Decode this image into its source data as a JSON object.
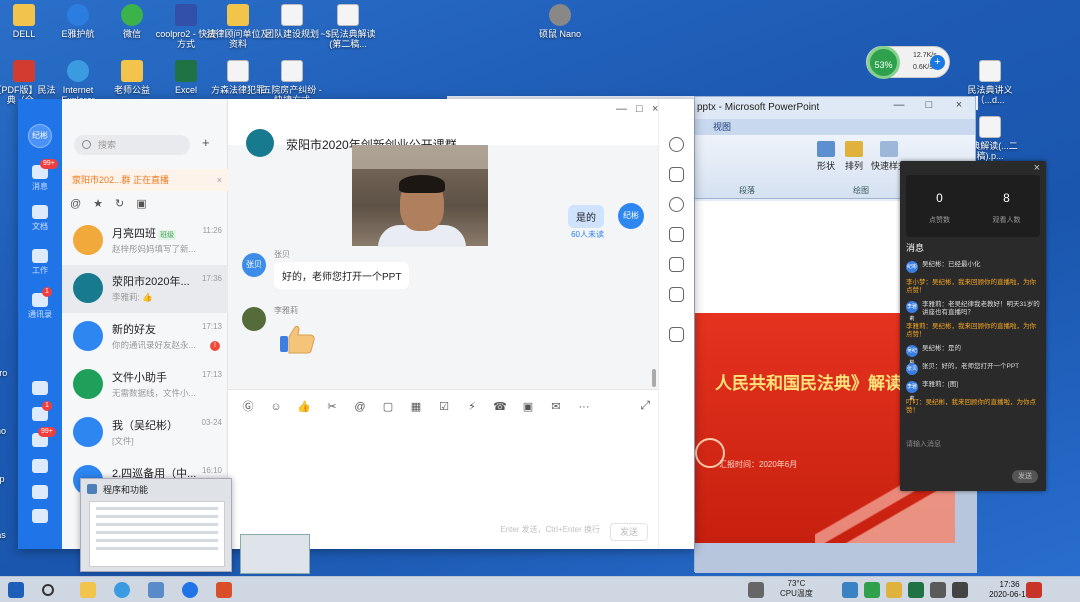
{
  "desktop": {
    "icons": [
      {
        "label": "DELL",
        "icon": "folder-icon"
      },
      {
        "label": "E雅护航",
        "icon": "edge-icon"
      },
      {
        "label": "微信",
        "icon": "wechat-icon"
      },
      {
        "label": "coolpro2 - 快捷方式",
        "icon": "coolpro-icon"
      },
      {
        "label": "法律顾问单位及资料",
        "icon": "folder-icon"
      },
      {
        "label": "团队建设规划",
        "icon": "doc-icon"
      },
      {
        "label": "~$民法典解读(第二稿...",
        "icon": "doc-icon"
      },
      {
        "label": "硕鼠 Nano",
        "icon": "nano-icon"
      },
      {
        "label": "【PDF版】民法典（全...",
        "icon": "pdf-icon"
      },
      {
        "label": "Internet Explorer",
        "icon": "ie-icon"
      },
      {
        "label": "老师公益",
        "icon": "folder-icon"
      },
      {
        "label": "Excel",
        "icon": "excel-icon"
      },
      {
        "label": "方森法律犯罪",
        "icon": "doc-icon"
      },
      {
        "label": "五院房产纠纷 - 快捷方式",
        "icon": "doc-icon"
      },
      {
        "label": "民法典讲义（...d...",
        "icon": "doc-icon"
      },
      {
        "label": "法典解读(...二稿).p...",
        "icon": "doc-icon"
      }
    ],
    "left_edge_labels": [
      "Acro",
      "Pho",
      "Alp",
      "Eas"
    ]
  },
  "widget": {
    "percent": "53%",
    "up": "12.7K/s",
    "down": "0.6K/s",
    "plus": "+"
  },
  "powerpoint": {
    "title": "pptx - Microsoft PowerPoint",
    "ribbon_tab": "视图",
    "buttons": [
      "形状",
      "排列",
      "快速样式"
    ],
    "groups": [
      "段落",
      "绘图"
    ],
    "slide_headline": "人民共和国民法典》解读",
    "slide_date": "汇报时间：2020年6月"
  },
  "live_panel": {
    "stat1_value": "0",
    "stat1_label": "点赞数",
    "stat2_value": "8",
    "stat2_label": "观看人数",
    "section": "消息",
    "messages": [
      {
        "who": "纪彬",
        "text": "吴纪彬：已经最小化",
        "sys": false
      },
      {
        "who": "",
        "text": "李小梦：吴纪彬，我来回顾你的直播啦，为你点赞！",
        "sys": true
      },
      {
        "who": "李雅莉",
        "text": "李雅莉：老吴纪律我老教好！明天31岁的讲座也有直播吗？",
        "sys": false
      },
      {
        "who": "",
        "text": "李雅莉：吴纪彬，我来回顾你的直播啦，为你点赞！",
        "sys": true
      },
      {
        "who": "吴纪彬",
        "text": "吴纪彬：是的",
        "sys": false
      },
      {
        "who": "张贝",
        "text": "张贝：好的，老师您打开一个PPT",
        "sys": false
      },
      {
        "who": "李雅莉",
        "text": "李雅莉：[图]",
        "sys": false
      },
      {
        "who": "",
        "text": "叮叮：吴纪彬，我来回顾你的直播啦，为你点赞！",
        "sys": true
      }
    ],
    "input_placeholder": "请输入消息",
    "send": "发送"
  },
  "dingtalk": {
    "rail": {
      "avatar": "纪彬",
      "items": [
        {
          "label": "消息",
          "badge": "99+"
        },
        {
          "label": "文档",
          "badge": ""
        },
        {
          "label": "工作",
          "badge": ""
        },
        {
          "label": "通讯录",
          "badge": "1"
        }
      ],
      "bottom_badges": [
        "1",
        "99+"
      ]
    },
    "search_placeholder": "搜索",
    "plus": "+",
    "live_bar": "荥阳市202...群 正在直播",
    "live_bar_close": "×",
    "tool_icons": [
      "@",
      "★",
      "↻",
      "▣"
    ],
    "chats": [
      {
        "name": "月亮四班",
        "tag": "班级",
        "preview": "赵梓彤妈妈填写了新...",
        "time": "11:26",
        "color": "#f2a93b",
        "badge": "",
        "selected": false
      },
      {
        "name": "荥阳市2020年...",
        "tag": "",
        "preview": "李雅莉: 👍",
        "time": "17:36",
        "color": "#177a8f",
        "badge": "",
        "selected": true
      },
      {
        "name": "新的好友",
        "tag": "",
        "preview": "你的通讯录好友赵永...",
        "time": "17:13",
        "color": "#2e86f1",
        "badge": "!",
        "selected": false
      },
      {
        "name": "文件小助手",
        "tag": "",
        "preview": "无需数据线，文件小...",
        "time": "17:13",
        "color": "#1fa05a",
        "badge": "",
        "selected": false
      },
      {
        "name": "我（吴纪彬）",
        "tag": "",
        "preview": "[文件]",
        "time": "03-24",
        "color": "#2e86f1",
        "badge": "",
        "selected": false
      },
      {
        "name": "2.四巡备用（中...",
        "tag": "",
        "preview": "陈彩琳16696070630...",
        "time": "16:10",
        "color": "#2e86f1",
        "badge": "",
        "selected": false
      }
    ],
    "chat": {
      "title": "荥阳市2020年创新创业公开课群",
      "out_msg": "是的",
      "out_read": "60人未读",
      "me_avatar": "纪彬",
      "in1_avatar": "张贝",
      "in1_name": "张贝",
      "in1_text": "好的，老师您打开一个PPT",
      "in2_name": "李雅莉",
      "toolbar": [
        "Ⓖ",
        "☺",
        "👍",
        "✂",
        "@",
        "▢",
        "▦",
        "☑",
        "⚡",
        "☎",
        "▣",
        "✉",
        "···"
      ],
      "expand": "⤢",
      "hint": "Enter 发送，Ctrl+Enter 换行",
      "send": "发送"
    },
    "window_controls": [
      "—",
      "□",
      "×"
    ]
  },
  "preview": {
    "title": "程序和功能"
  },
  "taskbar": {
    "temp": "73°C",
    "temp_label": "CPU温度",
    "time": "17:36",
    "date": "2020-06-18"
  }
}
